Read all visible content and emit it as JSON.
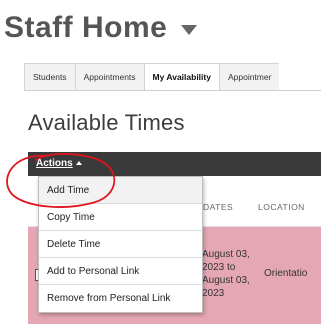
{
  "header": {
    "title": "Staff Home",
    "title_caret_icon": "caret-down-icon"
  },
  "tabs": [
    {
      "label": "Students",
      "active": false
    },
    {
      "label": "Appointments",
      "active": false
    },
    {
      "label": "My Availability",
      "active": true
    },
    {
      "label": "Appointmer",
      "active": false
    }
  ],
  "section": {
    "title": "Available Times"
  },
  "actions": {
    "label": "Actions",
    "caret_icon": "caret-up-icon",
    "menu": [
      {
        "label": "Add Time"
      },
      {
        "label": "Copy Time"
      },
      {
        "label": "Delete Time"
      },
      {
        "label": "Add to Personal Link"
      },
      {
        "label": "Remove from Personal Link"
      }
    ]
  },
  "table": {
    "columns": [
      "DATES",
      "LOCATION"
    ],
    "rows": [
      {
        "dates": "August 03,\n2023 to\nAugust 03,\n2023",
        "location": "Orientatio"
      }
    ]
  },
  "colors": {
    "header_bar": "#3a3a3a",
    "row_highlight": "#e5a7b4",
    "annotation_circle": "#e0141e"
  }
}
